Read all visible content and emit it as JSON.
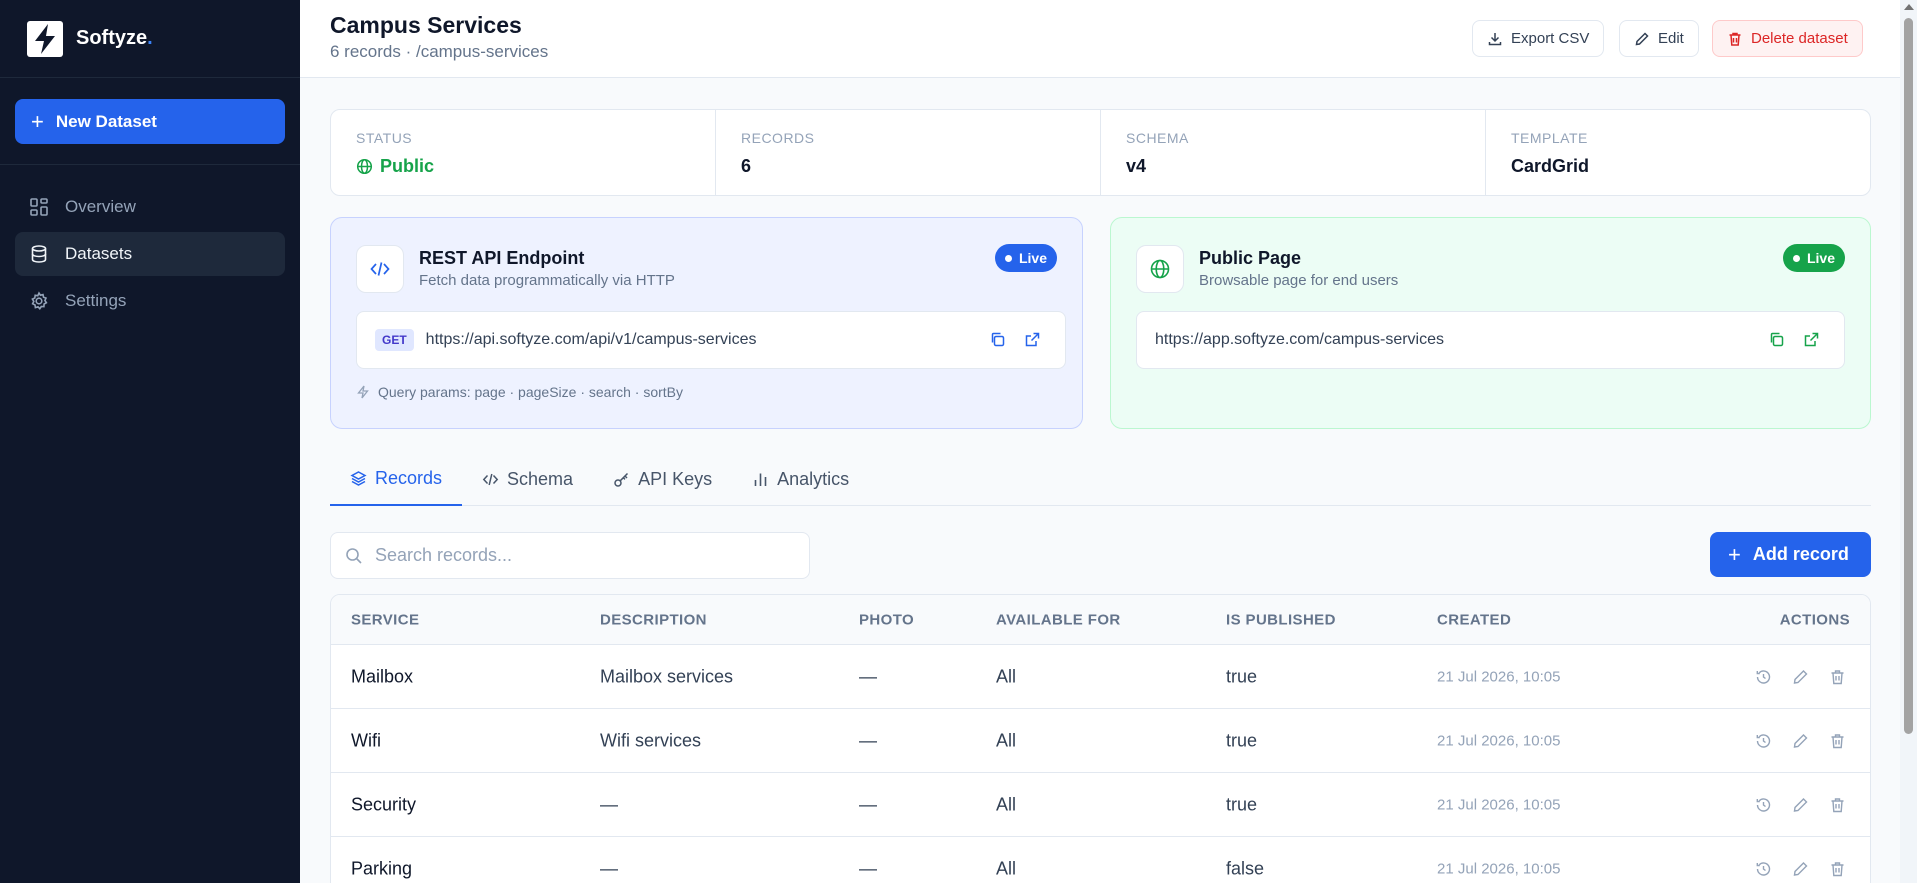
{
  "brand": {
    "name": "Softyze",
    "dot": "."
  },
  "sidebar": {
    "new_button": "New Dataset",
    "items": [
      {
        "label": "Overview",
        "icon": "grid-icon"
      },
      {
        "label": "Datasets",
        "icon": "database-icon"
      },
      {
        "label": "Settings",
        "icon": "gear-icon"
      }
    ]
  },
  "header": {
    "title": "Campus Services",
    "subtitle": "6 records · /campus-services",
    "export_label": "Export CSV",
    "edit_label": "Edit",
    "delete_label": "Delete dataset"
  },
  "stats": [
    {
      "label": "STATUS",
      "value": "Public"
    },
    {
      "label": "RECORDS",
      "value": "6"
    },
    {
      "label": "SCHEMA",
      "value": "v4"
    },
    {
      "label": "TEMPLATE",
      "value": "CardGrid"
    }
  ],
  "api_card": {
    "title": "REST API Endpoint",
    "subtitle": "Fetch data programmatically via HTTP",
    "badge": "Live",
    "method": "GET",
    "url": "https://api.softyze.com/api/v1/campus-services",
    "query": "Query params: page · pageSize · search · sortBy"
  },
  "public_card": {
    "title": "Public Page",
    "subtitle": "Browsable page for end users",
    "badge": "Live",
    "url": "https://app.softyze.com/campus-services"
  },
  "tabs": [
    {
      "label": "Records"
    },
    {
      "label": "Schema"
    },
    {
      "label": "API Keys"
    },
    {
      "label": "Analytics"
    }
  ],
  "search": {
    "placeholder": "Search records..."
  },
  "add_record_label": "Add record",
  "table": {
    "headers": [
      "SERVICE",
      "DESCRIPTION",
      "PHOTO",
      "AVAILABLE FOR",
      "IS PUBLISHED",
      "CREATED",
      "ACTIONS"
    ],
    "rows": [
      [
        "Mailbox",
        "Mailbox services",
        "—",
        "All",
        "true",
        "21 Jul 2026, 10:05"
      ],
      [
        "Wifi",
        "Wifi services",
        "—",
        "All",
        "true",
        "21 Jul 2026, 10:05"
      ],
      [
        "Security",
        "—",
        "—",
        "All",
        "true",
        "21 Jul 2026, 10:05"
      ],
      [
        "Parking",
        "—",
        "—",
        "All",
        "false",
        "21 Jul 2026, 10:05"
      ]
    ]
  },
  "colors": {
    "accent": "#2563eb",
    "success": "#16a34a",
    "danger": "#dc2626",
    "sidebar": "#0f172a"
  }
}
